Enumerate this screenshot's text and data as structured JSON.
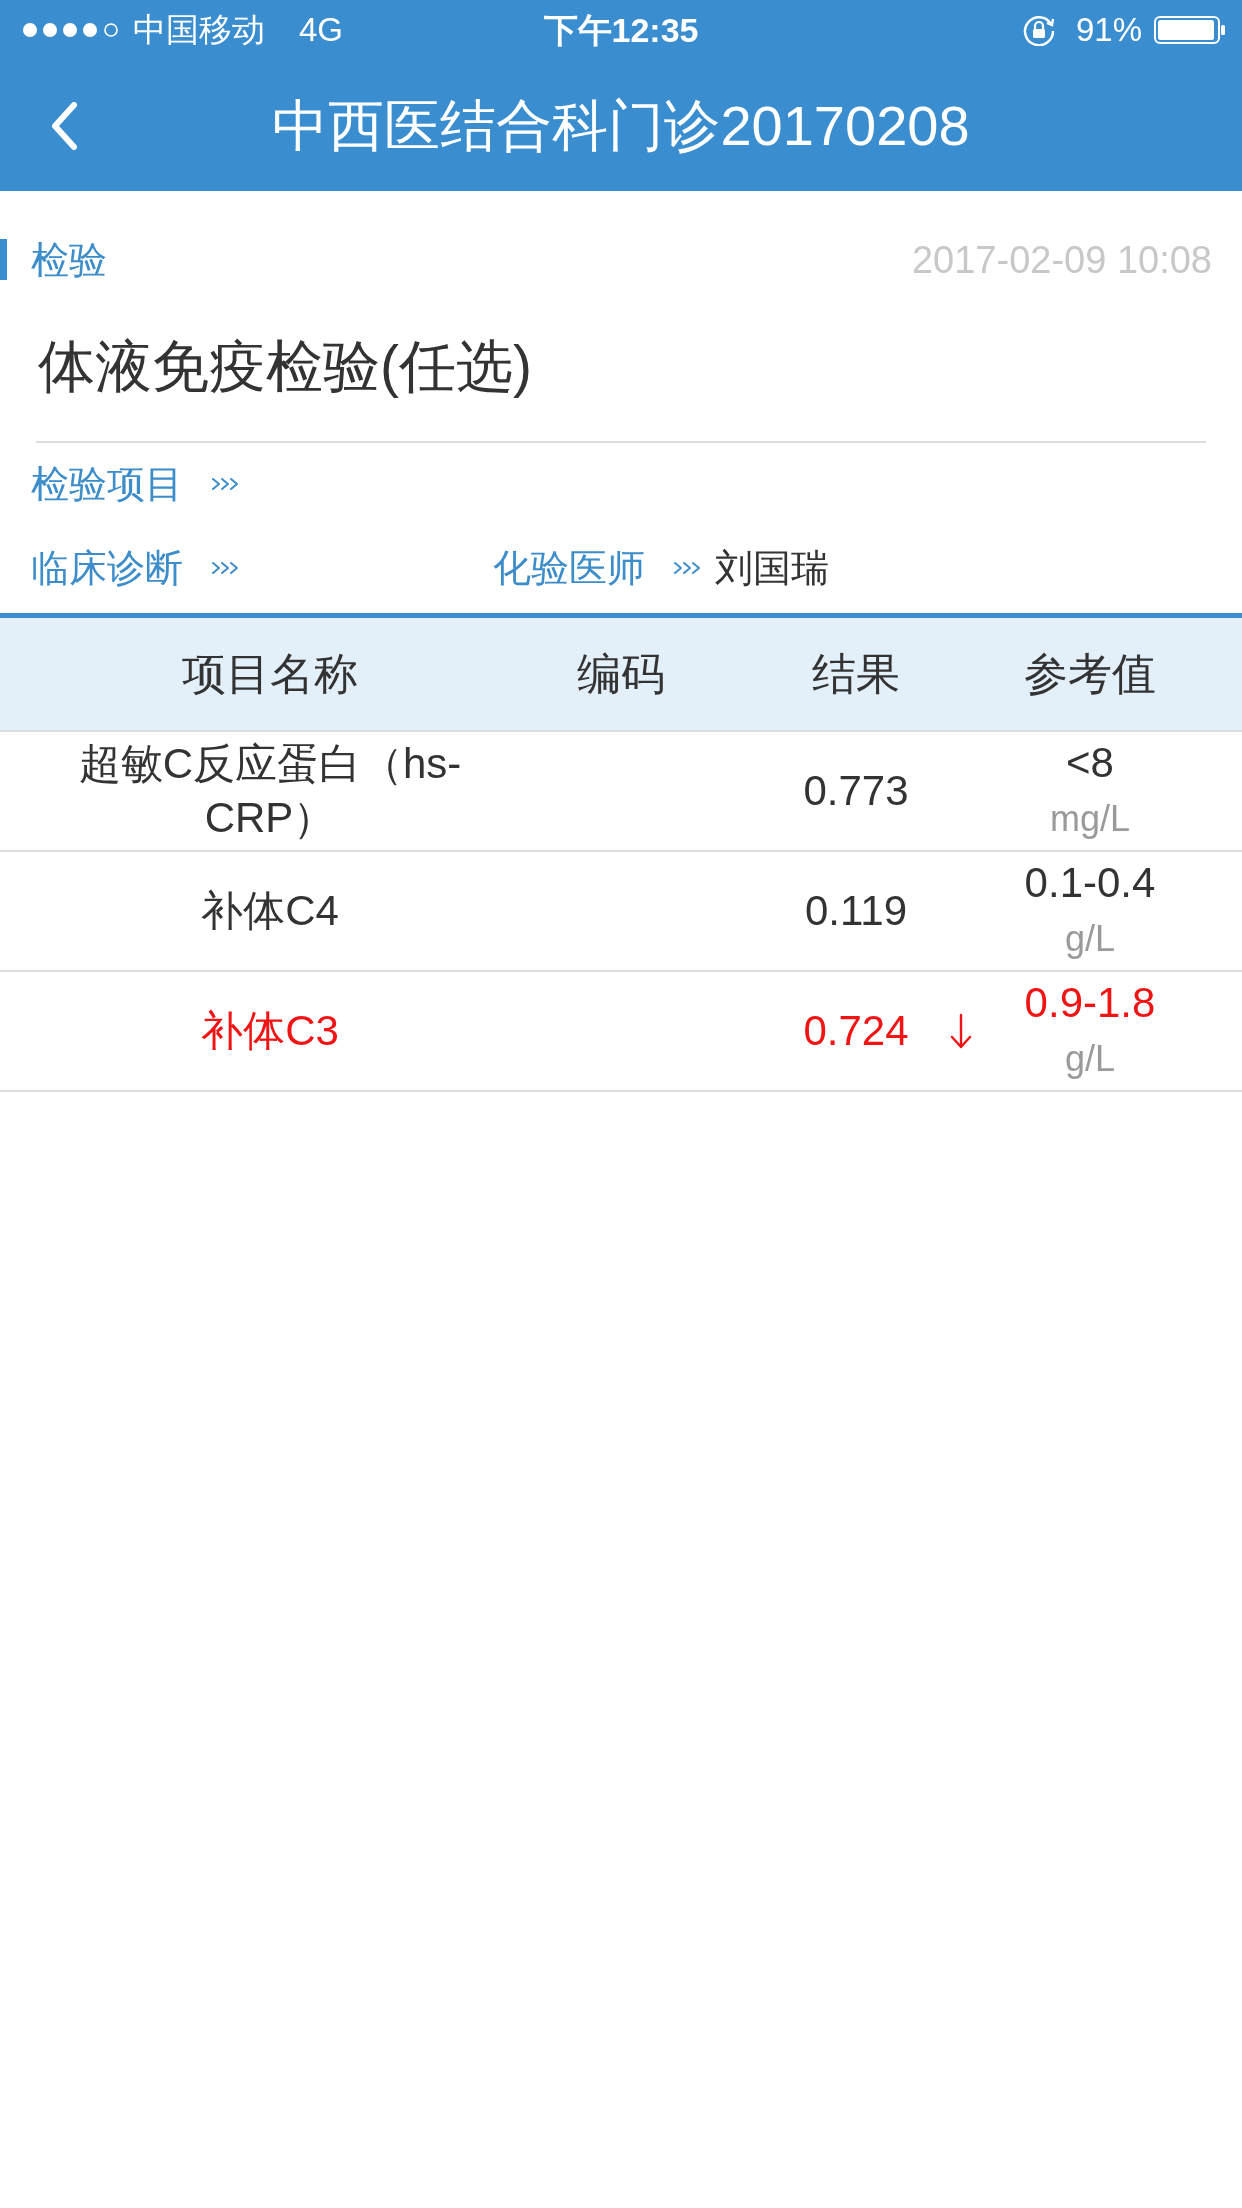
{
  "status_bar": {
    "carrier": "中国移动",
    "network": "4G",
    "time": "下午12:35",
    "battery": "91%"
  },
  "nav_bar": {
    "title": "中西医结合科门诊20170208"
  },
  "record": {
    "category": "检验",
    "datetime": "2017-02-09 10:08",
    "title": "体液免疫检验(任选)",
    "field_rows": [
      [
        {
          "label": "检验项目"
        }
      ],
      [
        {
          "label": "临床诊断"
        },
        {
          "label": "化验医师",
          "value": "刘国瑞"
        }
      ]
    ]
  },
  "table": {
    "columns": [
      "项目名称",
      "编码",
      "结果",
      "参考值"
    ],
    "rows": [
      {
        "name": "超敏C反应蛋白（hs-CRP）",
        "result": "0.773",
        "reference": "<8",
        "unit": "mg/L",
        "low": false
      },
      {
        "name": "补体C4",
        "result": "0.119",
        "reference": "0.1-0.4",
        "unit": "g/L",
        "low": false
      },
      {
        "name": "补体C3",
        "result": "0.724",
        "reference": "0.9-1.8",
        "unit": "g/L",
        "low": true
      }
    ]
  }
}
